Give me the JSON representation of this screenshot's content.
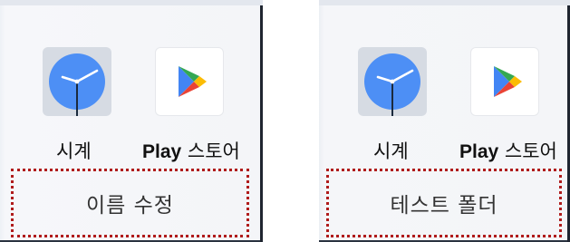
{
  "panels": [
    {
      "apps": [
        {
          "label": "시계",
          "icon": "clock-icon"
        },
        {
          "label_latin": "Play",
          "label_rest": " 스토어",
          "icon": "play-store-icon"
        }
      ],
      "folder_name": "이름 수정"
    },
    {
      "apps": [
        {
          "label": "시계",
          "icon": "clock-icon"
        },
        {
          "label_latin": "Play",
          "label_rest": " 스토어",
          "icon": "play-store-icon"
        }
      ],
      "folder_name": "테스트 폴더"
    }
  ],
  "colors": {
    "clock_face": "#4d8ff5",
    "clock_bg": "#d6dbe3",
    "highlight_border": "#b01c1c",
    "play_green": "#34a853",
    "play_blue": "#4285f4",
    "play_yellow": "#fbbc04",
    "play_red": "#ea4335"
  }
}
